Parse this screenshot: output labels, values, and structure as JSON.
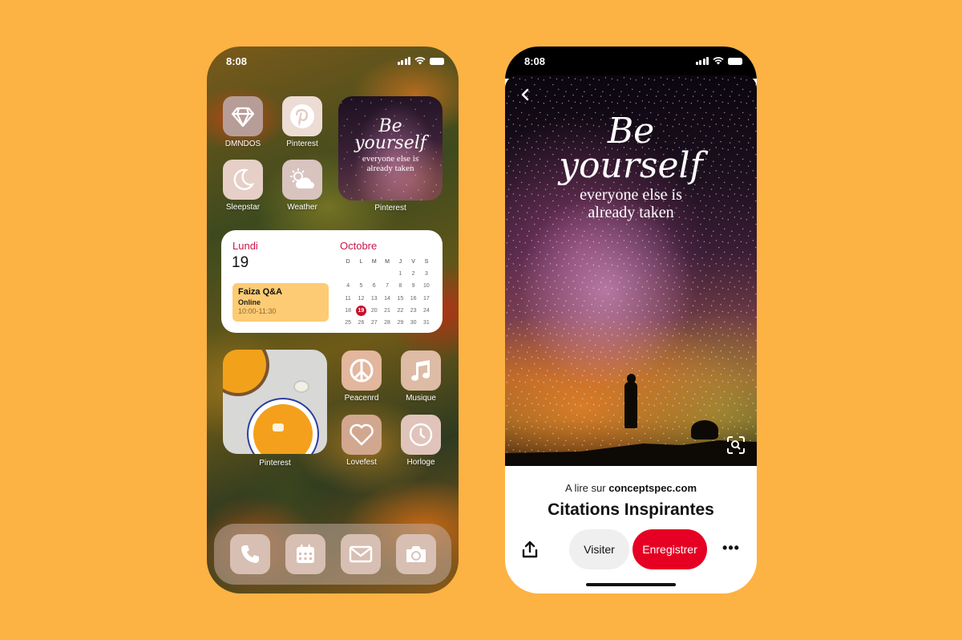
{
  "background_color": "#FDB244",
  "left_phone": {
    "status_time": "8:08",
    "apps": [
      {
        "label": "DMNDOS",
        "icon": "diamond-icon",
        "tile_color": "#b79d98"
      },
      {
        "label": "Pinterest",
        "icon": "pinterest-icon",
        "tile_color": "#e8d5cd"
      },
      {
        "label": "Sleepstar",
        "icon": "moon-icon",
        "tile_color": "#e5cfc6"
      },
      {
        "label": "Weather",
        "icon": "sun-cloud-icon",
        "tile_color": "#d8c3bf"
      },
      {
        "label": "Peacenrd",
        "icon": "peace-icon",
        "tile_color": "#e3b69e"
      },
      {
        "label": "Musique",
        "icon": "music-note-icon",
        "tile_color": "#ddbba5"
      },
      {
        "label": "Lovefest",
        "icon": "heart-icon",
        "tile_color": "#d2a790"
      },
      {
        "label": "Horloge",
        "icon": "clock-icon",
        "tile_color": "#e0c4bb"
      }
    ],
    "quote_widget": {
      "line1": "Be",
      "line2": "yourself",
      "line3": "everyone else is",
      "line4": "already taken",
      "label": "Pinterest"
    },
    "calendar": {
      "day_name": "Lundi",
      "day_number": "19",
      "month": "Octobre",
      "weekdays": [
        "D",
        "L",
        "M",
        "M",
        "J",
        "V",
        "S"
      ],
      "days": [
        "",
        "",
        "",
        "",
        "1",
        "2",
        "3",
        "4",
        "5",
        "6",
        "7",
        "8",
        "9",
        "10",
        "11",
        "12",
        "13",
        "14",
        "15",
        "16",
        "17",
        "18",
        "19",
        "20",
        "21",
        "22",
        "23",
        "24",
        "25",
        "26",
        "27",
        "28",
        "29",
        "30",
        "31"
      ],
      "today": "19",
      "accent_color": "#c8164a",
      "event": {
        "title": "Faiza Q&A",
        "location": "Online",
        "time": "10:00-11:30"
      }
    },
    "food_widget": {
      "label": "Pinterest"
    },
    "dock": [
      {
        "name": "phone",
        "icon": "phone-icon"
      },
      {
        "name": "calendar",
        "icon": "calendar-icon"
      },
      {
        "name": "mail",
        "icon": "mail-icon"
      },
      {
        "name": "camera",
        "icon": "camera-icon"
      }
    ]
  },
  "right_phone": {
    "status_time": "8:08",
    "pin_quote": {
      "line1": "Be",
      "line2": "yourself",
      "line3": "everyone else is",
      "line4": "already taken"
    },
    "source_prefix": "A lire sur",
    "source_domain": "conceptspec.com",
    "title": "Citations Inspirantes",
    "visit_label": "Visiter",
    "save_label": "Enregistrer",
    "save_color": "#e60023",
    "more_label": "•••"
  }
}
